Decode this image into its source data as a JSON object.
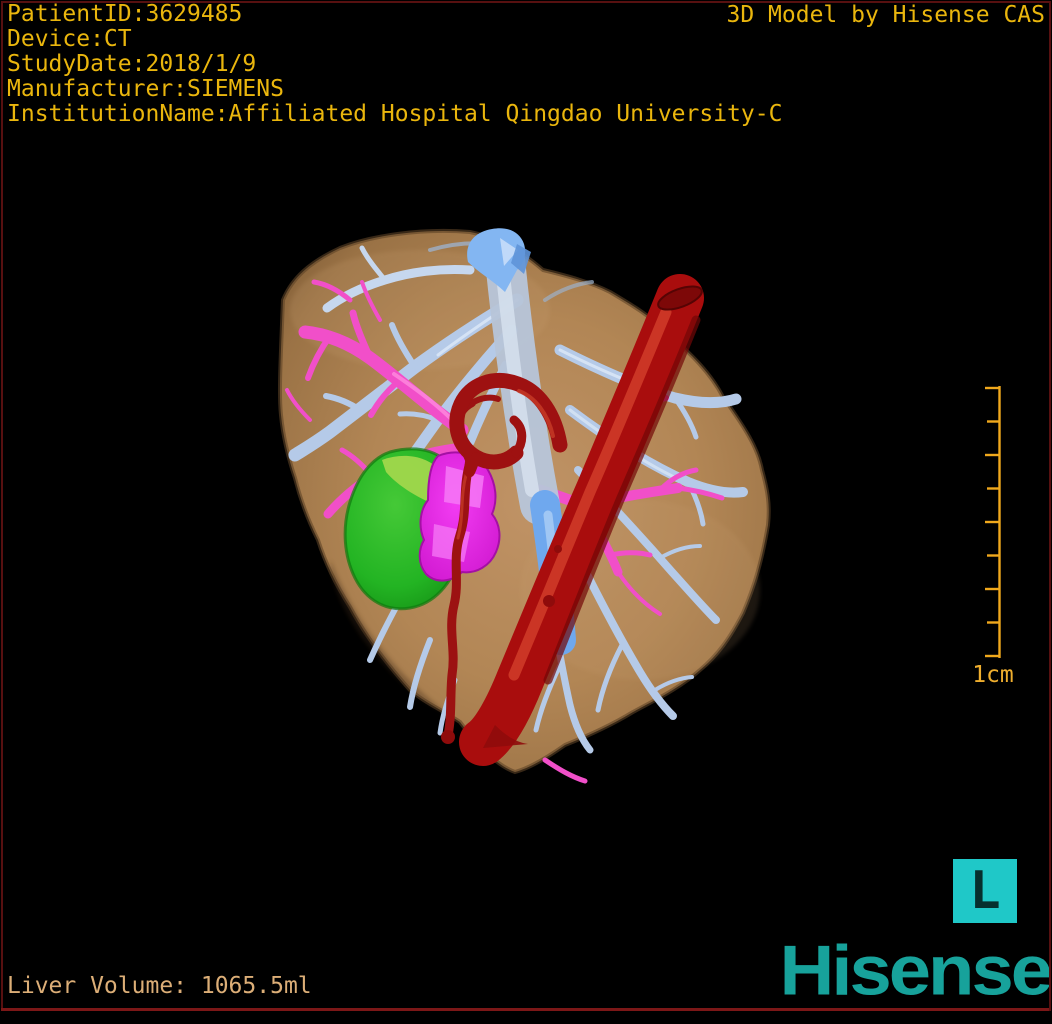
{
  "header": {
    "info_lines": [
      "PatientID:3629485",
      "Device:CT",
      "StudyDate:2018/1/9",
      "Manufacturer:SIEMENS",
      "InstitutionName:Affiliated Hospital Qingdao University-C"
    ],
    "title": "3D Model by Hisense CAS"
  },
  "scale_bar": {
    "label": "1cm",
    "tick_count": 9,
    "interval_unit": "1cm"
  },
  "orientation": {
    "label": "L"
  },
  "footer": {
    "volume_text": "Liver Volume: 1065.5ml"
  },
  "branding": {
    "logo_text": "Hisense"
  },
  "model": {
    "structures": [
      {
        "name": "liver",
        "color": "#b98e5f"
      },
      {
        "name": "hepatic-veins",
        "color": "#b5cae8"
      },
      {
        "name": "portal-veins",
        "color": "#f14fc9"
      },
      {
        "name": "inferior-vena-cava",
        "color": "#84b6f1"
      },
      {
        "name": "aorta",
        "color": "#a90d0d"
      },
      {
        "name": "hepatic-artery",
        "color": "#9c1212"
      },
      {
        "name": "gallbladder",
        "color": "#2dbe2d"
      },
      {
        "name": "portal-vein-trunk",
        "color": "#e02ce0"
      }
    ]
  },
  "colors": {
    "annotation_text": "#eab60d",
    "volume_text": "#dcae77",
    "scale_bar": "#f0a81c",
    "logo_teal": "#17a29b",
    "marker_background": "#1fc8c8",
    "marker_glyph": "#06302e",
    "frame_border": "#571010",
    "background": "#000000"
  }
}
